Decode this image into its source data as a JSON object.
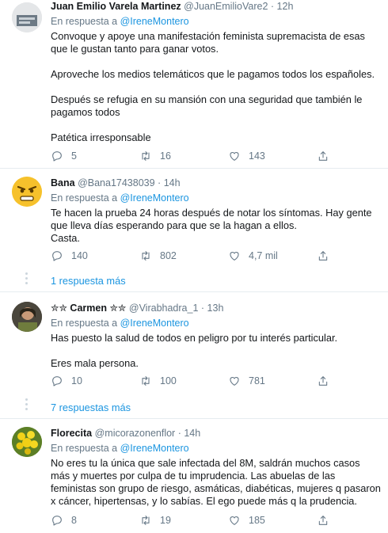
{
  "tweets": [
    {
      "name": "Juan Emilio Varela Martinez",
      "handle": "@JuanEmilioVare2",
      "dot": "·",
      "time": "12h",
      "reply_prefix": "En respuesta a",
      "reply_mention": "@IreneMontero",
      "lines": [
        "Convoque y apoye una manifestación feminista supremacista de esas que le gustan tanto para ganar votos.",
        "",
        "Aproveche los medios telemáticos que le pagamos todos los españoles.",
        "",
        "Después se refugia en su mansión con una seguridad que también le pagamos todos",
        "",
        "Patética irresponsable"
      ],
      "replies": "5",
      "retweets": "16",
      "likes": "143"
    },
    {
      "name": "Bana",
      "handle": "@Bana17438039",
      "dot": "·",
      "time": "14h",
      "reply_prefix": "En respuesta a",
      "reply_mention": "@IreneMontero",
      "lines": [
        "Te hacen la prueba 24 horas después de notar los síntomas. Hay gente que lleva días esperando para que se la hagan a ellos.",
        "Casta."
      ],
      "replies": "140",
      "retweets": "802",
      "likes": "4,7 mil"
    },
    {
      "name": "✮✮ Carmen ✮✮",
      "handle": "@Virabhadra_1",
      "dot": "·",
      "time": "13h",
      "reply_prefix": "En respuesta a",
      "reply_mention": "@IreneMontero",
      "lines": [
        "Has puesto la salud de todos en peligro por tu interés particular.",
        "",
        "Eres mala persona."
      ],
      "replies": "10",
      "retweets": "100",
      "likes": "781"
    },
    {
      "name": "Florecita",
      "handle": "@micorazonenflor",
      "dot": "·",
      "time": "14h",
      "reply_prefix": "En respuesta a",
      "reply_mention": "@IreneMontero",
      "lines": [
        "No eres tu la única que sale infectada del 8M, saldrán muchos casos más y muertes por culpa de tu imprudencia. Las abuelas de las feministas son grupo de riesgo, asmáticas, diabéticas, mujeres q pasaron x cáncer, hipertensas, y lo sabías. El ego puede más q la prudencia."
      ],
      "replies": "8",
      "retweets": "19",
      "likes": "185"
    }
  ],
  "more_replies": [
    "1 respuesta más",
    "7 respuestas más"
  ],
  "icons": {
    "reply": "reply-icon",
    "retweet": "retweet-icon",
    "like": "heart-icon",
    "share": "share-icon"
  },
  "colors": {
    "link": "#1b95e0",
    "muted": "#657786",
    "text": "#14171a",
    "divider": "#e6ecf0"
  }
}
